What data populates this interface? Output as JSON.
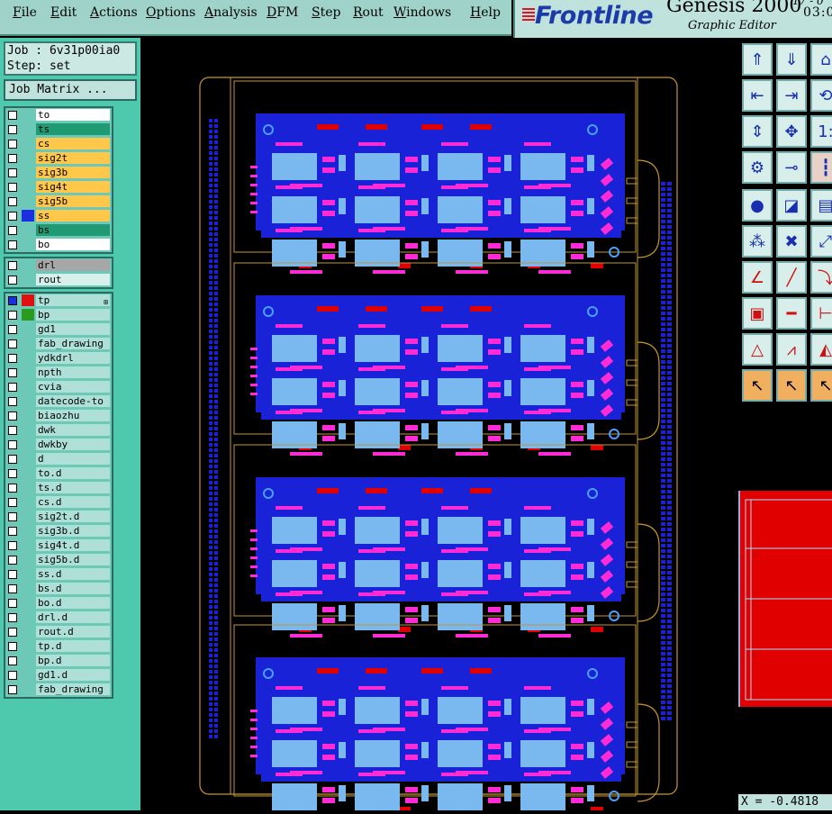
{
  "menu": [
    {
      "label": "File",
      "u": "F",
      "rest": "ile"
    },
    {
      "label": "Edit",
      "u": "E",
      "rest": "dit"
    },
    {
      "label": "Actions",
      "u": "A",
      "rest": "ctions"
    },
    {
      "label": "Options",
      "u": "O",
      "rest": "ptions"
    },
    {
      "label": "Analysis",
      "u": "A",
      "rest": "nalysis"
    },
    {
      "label": "DFM",
      "u": "D",
      "rest": "FM"
    },
    {
      "label": "Step",
      "u": "S",
      "rest": "tep"
    },
    {
      "label": "Rout",
      "u": "R",
      "rest": "out"
    },
    {
      "label": "Windows",
      "u": "W",
      "rest": "indows"
    },
    {
      "label": "Help",
      "u": "H",
      "rest": "elp"
    }
  ],
  "brand": {
    "logo": "Frontline",
    "product": "Genesis 2000",
    "subtitle": "Graphic Editor",
    "date": "17 - 0",
    "time": "03:0"
  },
  "job": {
    "job_line": "Job : 6v31p00ia0",
    "step_line": "Step: set",
    "matrix_button": "Job Matrix ..."
  },
  "layer_groups": [
    [
      {
        "name": "to",
        "style": "board",
        "swatch": ""
      },
      {
        "name": "ts",
        "style": "green",
        "swatch": ""
      },
      {
        "name": "cs",
        "style": "yellow",
        "swatch": ""
      },
      {
        "name": "sig2t",
        "style": "yellow",
        "swatch": ""
      },
      {
        "name": "sig3b",
        "style": "yellow",
        "swatch": ""
      },
      {
        "name": "sig4t",
        "style": "yellow",
        "swatch": ""
      },
      {
        "name": "sig5b",
        "style": "yellow",
        "swatch": ""
      },
      {
        "name": "ss",
        "style": "yellow",
        "swatch": "#1a2fe0"
      },
      {
        "name": "bs",
        "style": "green",
        "swatch": ""
      },
      {
        "name": "bo",
        "style": "board",
        "swatch": ""
      }
    ],
    [
      {
        "name": "drl",
        "style": "gray",
        "swatch": ""
      },
      {
        "name": "rout",
        "style": "light",
        "swatch": ""
      }
    ],
    [
      {
        "name": "tp",
        "style": "teal",
        "swatch": "#e01010",
        "active": true
      },
      {
        "name": "bp",
        "style": "teal",
        "swatch": "#2a9a20"
      },
      {
        "name": "gd1",
        "style": "teal",
        "swatch": ""
      },
      {
        "name": "fab_drawing",
        "style": "teal",
        "swatch": ""
      },
      {
        "name": "ydkdrl",
        "style": "teal",
        "swatch": ""
      },
      {
        "name": "npth",
        "style": "teal",
        "swatch": ""
      },
      {
        "name": "cvia",
        "style": "teal",
        "swatch": ""
      },
      {
        "name": "datecode-to",
        "style": "teal",
        "swatch": ""
      },
      {
        "name": "biaozhu",
        "style": "teal",
        "swatch": ""
      },
      {
        "name": "dwk",
        "style": "teal",
        "swatch": ""
      },
      {
        "name": "dwkby",
        "style": "teal",
        "swatch": ""
      },
      {
        "name": "d",
        "style": "teal",
        "swatch": ""
      },
      {
        "name": "to.d",
        "style": "teal",
        "swatch": ""
      },
      {
        "name": "ts.d",
        "style": "teal",
        "swatch": ""
      },
      {
        "name": "cs.d",
        "style": "teal",
        "swatch": ""
      },
      {
        "name": "sig2t.d",
        "style": "teal",
        "swatch": ""
      },
      {
        "name": "sig3b.d",
        "style": "teal",
        "swatch": ""
      },
      {
        "name": "sig4t.d",
        "style": "teal",
        "swatch": ""
      },
      {
        "name": "sig5b.d",
        "style": "teal",
        "swatch": ""
      },
      {
        "name": "ss.d",
        "style": "teal",
        "swatch": ""
      },
      {
        "name": "bs.d",
        "style": "teal",
        "swatch": ""
      },
      {
        "name": "bo.d",
        "style": "teal",
        "swatch": ""
      },
      {
        "name": "drl.d",
        "style": "teal",
        "swatch": ""
      },
      {
        "name": "rout.d",
        "style": "teal",
        "swatch": ""
      },
      {
        "name": "tp.d",
        "style": "teal",
        "swatch": ""
      },
      {
        "name": "bp.d",
        "style": "teal",
        "swatch": ""
      },
      {
        "name": "gd1.d",
        "style": "teal",
        "swatch": ""
      },
      {
        "name": "fab_drawing",
        "style": "teal",
        "swatch": ""
      }
    ]
  ],
  "colors": {
    "board_blue": "#1a22d8",
    "pad_light": "#7ab8f0",
    "pad_pink": "#ff2bd6",
    "pad_red": "#e00000",
    "outline": "#c8962a"
  },
  "status": {
    "coord": "X = -0.4818"
  }
}
